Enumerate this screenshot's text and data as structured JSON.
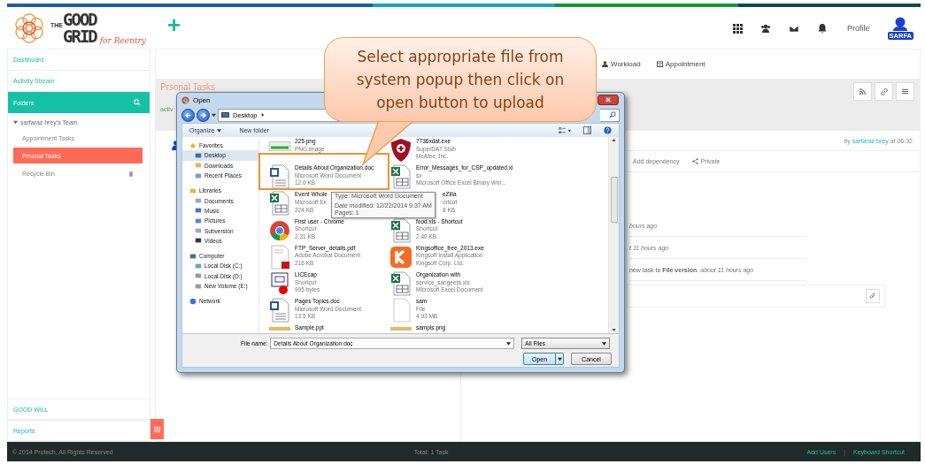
{
  "header": {
    "logo": {
      "line_1": "THE",
      "line_2": "GOOD",
      "line_3": "GRID",
      "tagline": "for Reentry"
    },
    "add_label": "+",
    "profile_label": "Profile",
    "avatar_label": "SARFA"
  },
  "sidebar": {
    "items": [
      {
        "label": "Dashboard"
      },
      {
        "label": "Activity Stream"
      }
    ],
    "folders_label": "Folders",
    "team": {
      "label": "sarfaraz brey's Team",
      "expanded": true,
      "children": [
        {
          "label": "Appointment Tasks",
          "selected": false,
          "kind": "folder"
        },
        {
          "label": "Prsonal Tasks",
          "selected": true,
          "kind": "folder"
        },
        {
          "label": "Recycle Bin",
          "selected": false,
          "kind": "trash"
        }
      ]
    },
    "bottom_items": [
      {
        "label": "GOOD WILL"
      },
      {
        "label": "Reports"
      }
    ]
  },
  "tabs": [
    {
      "label": "Workload",
      "kind": "user"
    },
    {
      "label": "Appointment",
      "kind": "calendar"
    }
  ],
  "task_list": {
    "title": "Prsonal Tasks",
    "tag": "activ"
  },
  "task_detail": {
    "by": "by",
    "author": "sarfaraz brey",
    "time": "at 06:32",
    "actions": [
      {
        "label": "Add dependency",
        "kind": "plain"
      },
      {
        "label": "Private",
        "kind": "share"
      }
    ],
    "activity": [
      {
        "time": "hours ago"
      },
      {
        "time": "t 11 hours ago"
      },
      {
        "text": "new task to **File version**",
        "time": "about 11 hours ago"
      }
    ]
  },
  "dialog": {
    "title": "Open",
    "location": "Desktop",
    "toolbar": [
      "Organize",
      "New folder"
    ],
    "nav": [
      {
        "label": "Favorites",
        "kind": "star",
        "group": true,
        "selected": false
      },
      {
        "label": "Desktop",
        "kind": "desktop",
        "group": false,
        "selected": true
      },
      {
        "label": "Downloads",
        "kind": "folder",
        "group": false,
        "selected": false
      },
      {
        "label": "Recent Places",
        "kind": "recent",
        "group": false,
        "selected": false
      },
      {
        "label": "Libraries",
        "kind": "library",
        "group": true,
        "selected": false
      },
      {
        "label": "Documents",
        "kind": "doc",
        "group": false,
        "selected": false
      },
      {
        "label": "Music",
        "kind": "music",
        "group": false,
        "selected": false
      },
      {
        "label": "Pictures",
        "kind": "pictures",
        "group": false,
        "selected": false
      },
      {
        "label": "Subversion",
        "kind": "doc",
        "group": false,
        "selected": false
      },
      {
        "label": "Videos",
        "kind": "video",
        "group": false,
        "selected": false
      },
      {
        "label": "Computer",
        "kind": "computer",
        "group": true,
        "selected": false
      },
      {
        "label": "Local Disk (C:)",
        "kind": "disk",
        "group": false,
        "selected": false
      },
      {
        "label": "Local Disk (D:)",
        "kind": "drive",
        "group": false,
        "selected": false
      },
      {
        "label": "New Volume (E:)",
        "kind": "drive",
        "group": false,
        "selected": false
      },
      {
        "label": "Network",
        "kind": "network",
        "group": true,
        "selected": false
      }
    ],
    "files": [
      {
        "name": "225.png",
        "lines": [
          "PNG image"
        ],
        "kind": "image"
      },
      {
        "name": "7736xdat.exe",
        "lines": [
          "SuperDAT Stub",
          "McAfee, Inc."
        ],
        "kind": "shield"
      },
      {
        "name": "Details About Organization.doc",
        "lines": [
          "Microsoft Word Document",
          "12.0 KB"
        ],
        "kind": "word"
      },
      {
        "name": "Error_Messages_for_CSP_updated.xl",
        "lines": [
          "sx",
          "Microsoft Office Excel Binary Wor..."
        ],
        "kind": "excel"
      },
      {
        "name": "Event Whole",
        "lines": [
          "Microsoft Ex",
          "224 KB"
        ],
        "kind": "excel"
      },
      {
        "name": "eZilla",
        "lines": [
          "ortcut",
          "8 KB"
        ],
        "kind": "covered"
      },
      {
        "name": "First user - Chrome",
        "lines": [
          "Shortcut",
          "2.31 KB"
        ],
        "kind": "chrome"
      },
      {
        "name": "food.xls - Shortcut",
        "lines": [
          "Shortcut",
          "2.40 KB"
        ],
        "kind": "excel"
      },
      {
        "name": "FTP_Server_details.pdf",
        "lines": [
          "Adobe Acrobat Document",
          "216 KB"
        ],
        "kind": "pdf"
      },
      {
        "name": "Kingsoffice_free_2013.exe",
        "lines": [
          "Kingsoft Install Application",
          "Kingsoft Corp. Ltd."
        ],
        "kind": "kingsoft"
      },
      {
        "name": "LICEcap",
        "lines": [
          "Shortcut",
          "995 bytes"
        ],
        "kind": "capture"
      },
      {
        "name": "Organization with",
        "lines": [
          "service_sangeeta.xls",
          "Microsoft Excel Document"
        ],
        "kind": "excel"
      },
      {
        "name": "Pages Topics.doc",
        "lines": [
          "Microsoft Word Document",
          "13.5 KB"
        ],
        "kind": "word"
      },
      {
        "name": "sam",
        "lines": [
          "File",
          "4.93 MB"
        ],
        "kind": "blank"
      },
      {
        "name": "Sample.ppt",
        "kind": "strip"
      },
      {
        "name": "sampls.png",
        "kind": "strip"
      }
    ],
    "tooltip": [
      "Type: Microsoft Word Document",
      "Date modified: 12/22/2014 9:37 AM",
      "Pages: 1"
    ],
    "file_name_label": "File name:",
    "file_name": "Details About Organization.doc",
    "filter": "All Files",
    "buttons": [
      {
        "label": "Open",
        "kind": "primary"
      },
      {
        "label": "Cancel",
        "kind": "plain"
      }
    ]
  },
  "callout": {
    "text": "Select appropriate file from system popup then click on open button to upload"
  },
  "footer": {
    "copyright": "© 2014 Protech, All Rights Reserved",
    "total": "Total: 1 Task",
    "links": [
      "Add Users",
      "Keyboard Shortcut"
    ],
    "separator": "|"
  }
}
